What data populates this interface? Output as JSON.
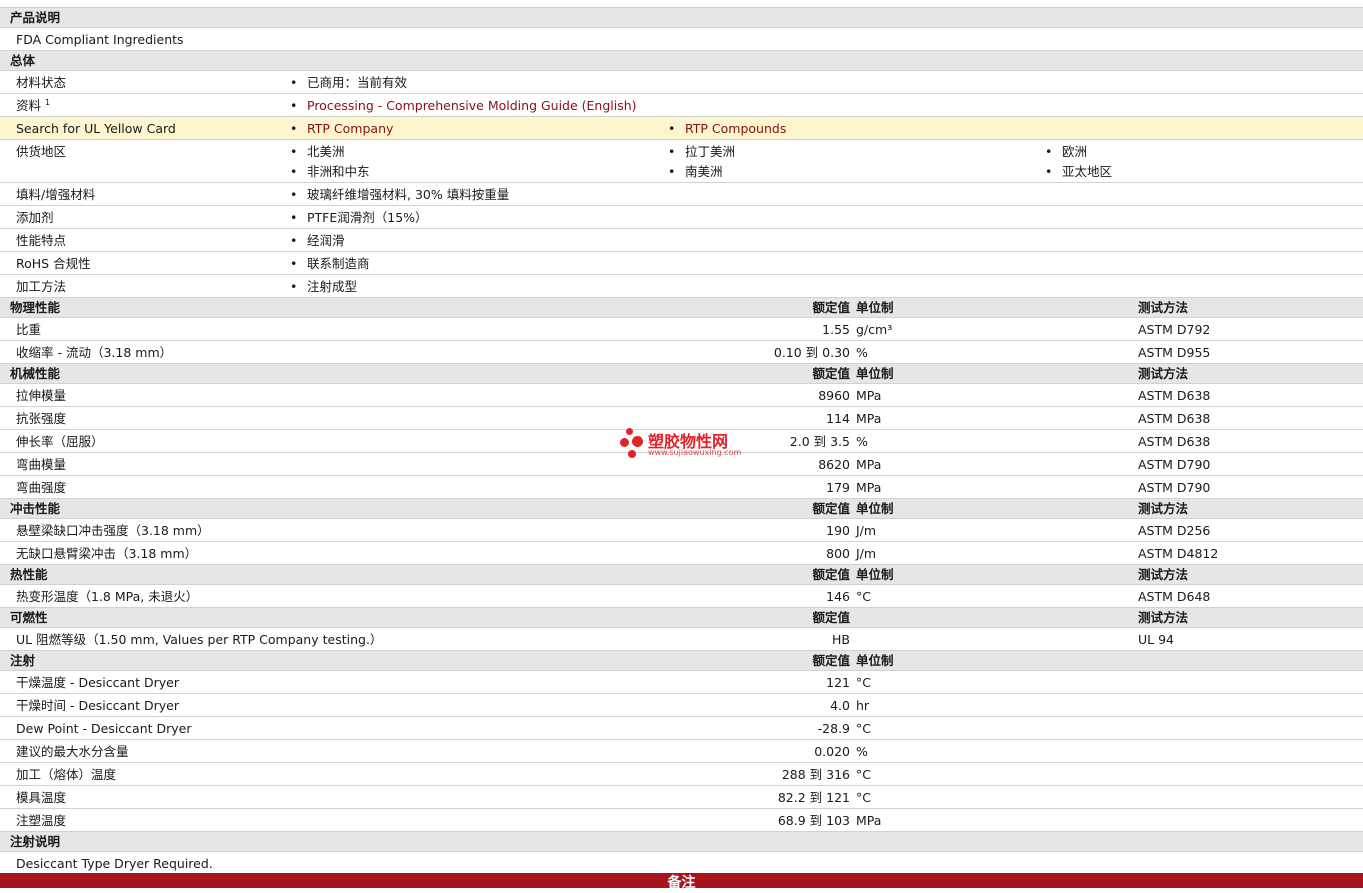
{
  "product_desc": {
    "title": "产品说明",
    "text": "FDA Compliant Ingredients"
  },
  "general": {
    "title": "总体",
    "status": {
      "label": "材料状态",
      "value": "已商用：当前有效"
    },
    "docs": {
      "label": "资料",
      "sup": "1",
      "value": "Processing - Comprehensive Molding Guide (English)"
    },
    "ul": {
      "label": "Search for UL Yellow Card",
      "v1": "RTP Company",
      "v2": "RTP Compounds"
    },
    "regions": {
      "label": "供货地区",
      "items": [
        "北美洲",
        "拉丁美洲",
        "欧洲",
        "非洲和中东",
        "南美洲",
        "亚太地区"
      ]
    },
    "filler": {
      "label": "填料/增强材料",
      "value": "玻璃纤维增强材料, 30% 填料按重量"
    },
    "additive": {
      "label": "添加剂",
      "value": "PTFE润滑剂（15%）"
    },
    "features": {
      "label": "性能特点",
      "value": "经润滑"
    },
    "rohs": {
      "label": "RoHS 合规性",
      "value": "联系制造商"
    },
    "process": {
      "label": "加工方法",
      "value": "注射成型"
    }
  },
  "cols": {
    "value": "额定值",
    "unit": "单位制",
    "method": "测试方法"
  },
  "sections": [
    {
      "title": "物理性能",
      "show_unit": true,
      "show_method": true,
      "rows": [
        {
          "label": "比重",
          "value": "1.55",
          "unit": "g/cm³",
          "method": "ASTM D792"
        },
        {
          "label": "收缩率 - 流动（3.18 mm）",
          "value": "0.10 到  0.30",
          "unit": "%",
          "method": "ASTM D955"
        }
      ]
    },
    {
      "title": "机械性能",
      "show_unit": true,
      "show_method": true,
      "rows": [
        {
          "label": "拉伸模量",
          "value": "8960",
          "unit": "MPa",
          "method": "ASTM D638"
        },
        {
          "label": "抗张强度",
          "value": "114",
          "unit": "MPa",
          "method": "ASTM D638"
        },
        {
          "label": "伸长率（屈服）",
          "value": "2.0 到  3.5",
          "unit": "%",
          "method": "ASTM D638"
        },
        {
          "label": "弯曲模量",
          "value": "8620",
          "unit": "MPa",
          "method": "ASTM D790"
        },
        {
          "label": "弯曲强度",
          "value": "179",
          "unit": "MPa",
          "method": "ASTM D790"
        }
      ]
    },
    {
      "title": "冲击性能",
      "show_unit": true,
      "show_method": true,
      "rows": [
        {
          "label": "悬壁梁缺口冲击强度（3.18 mm）",
          "value": "190",
          "unit": "J/m",
          "method": "ASTM D256"
        },
        {
          "label": "无缺口悬臂梁冲击（3.18 mm）",
          "value": "800",
          "unit": "J/m",
          "method": "ASTM D4812"
        }
      ]
    },
    {
      "title": "热性能",
      "show_unit": true,
      "show_method": true,
      "rows": [
        {
          "label": "热变形温度（1.8 MPa, 未退火）",
          "value": "146",
          "unit": "°C",
          "method": "ASTM D648"
        }
      ]
    },
    {
      "title": "可燃性",
      "show_unit": false,
      "show_method": true,
      "rows": [
        {
          "label": "UL 阻燃等级（1.50 mm, Values per RTP Company testing.）",
          "value": "HB",
          "unit": "",
          "method": "UL 94"
        }
      ]
    },
    {
      "title": "注射",
      "show_unit": true,
      "show_method": false,
      "rows": [
        {
          "label": "干燥温度 - Desiccant Dryer",
          "value": "121",
          "unit": "°C",
          "method": ""
        },
        {
          "label": "干燥时间 - Desiccant Dryer",
          "value": "4.0",
          "unit": "hr",
          "method": ""
        },
        {
          "label": "Dew Point - Desiccant Dryer",
          "value": "-28.9",
          "unit": "°C",
          "method": ""
        },
        {
          "label": "建议的最大水分含量",
          "value": "0.020",
          "unit": "%",
          "method": ""
        },
        {
          "label": "加工（熔体）温度",
          "value": "288 到  316",
          "unit": "°C",
          "method": ""
        },
        {
          "label": "模具温度",
          "value": "82.2 到  121",
          "unit": "°C",
          "method": ""
        },
        {
          "label": "注塑温度",
          "value": "68.9 到  103",
          "unit": "MPa",
          "method": ""
        }
      ]
    }
  ],
  "injection_note": {
    "title": "注射说明",
    "text": "Desiccant Type Dryer Required."
  },
  "footer": {
    "label": "备注"
  },
  "watermark": {
    "name": "塑胶物性网",
    "url": "www.sujiaowuxing.com"
  }
}
